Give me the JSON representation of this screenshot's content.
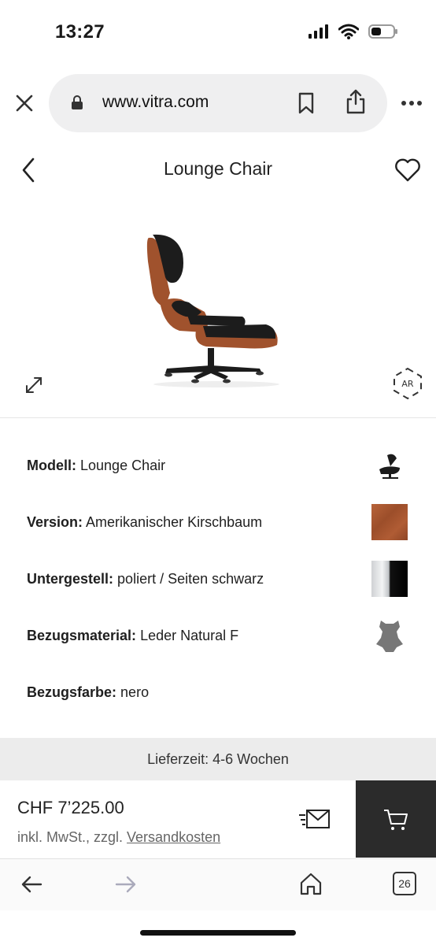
{
  "status": {
    "time": "13:27"
  },
  "browser": {
    "url": "www.vitra.com",
    "tab_count": "26"
  },
  "header": {
    "title": "Lounge Chair"
  },
  "config": [
    {
      "label": "Modell:",
      "value": "Lounge Chair",
      "swatch": "chair-thumbnail"
    },
    {
      "label": "Version:",
      "value": "Amerikanischer Kirschbaum",
      "swatch": "cherry-wood"
    },
    {
      "label": "Untergestell:",
      "value": "poliert / Seiten schwarz",
      "swatch": "polished-black"
    },
    {
      "label": "Bezugsmaterial:",
      "value": "Leder Natural F",
      "swatch": "leather"
    },
    {
      "label": "Bezugsfarbe:",
      "value": "nero",
      "swatch": ""
    }
  ],
  "delivery": {
    "text": "Lieferzeit: 4-6 Wochen"
  },
  "price": {
    "amount": "CHF 7’225.00",
    "note_prefix": "inkl. MwSt., zzgl. ",
    "note_link": "Versandkosten"
  },
  "colors": {
    "cart_bg": "#2b2b2b",
    "delivery_bg": "#ececec",
    "url_pill": "#efeff0",
    "wood": "#a0522d"
  }
}
